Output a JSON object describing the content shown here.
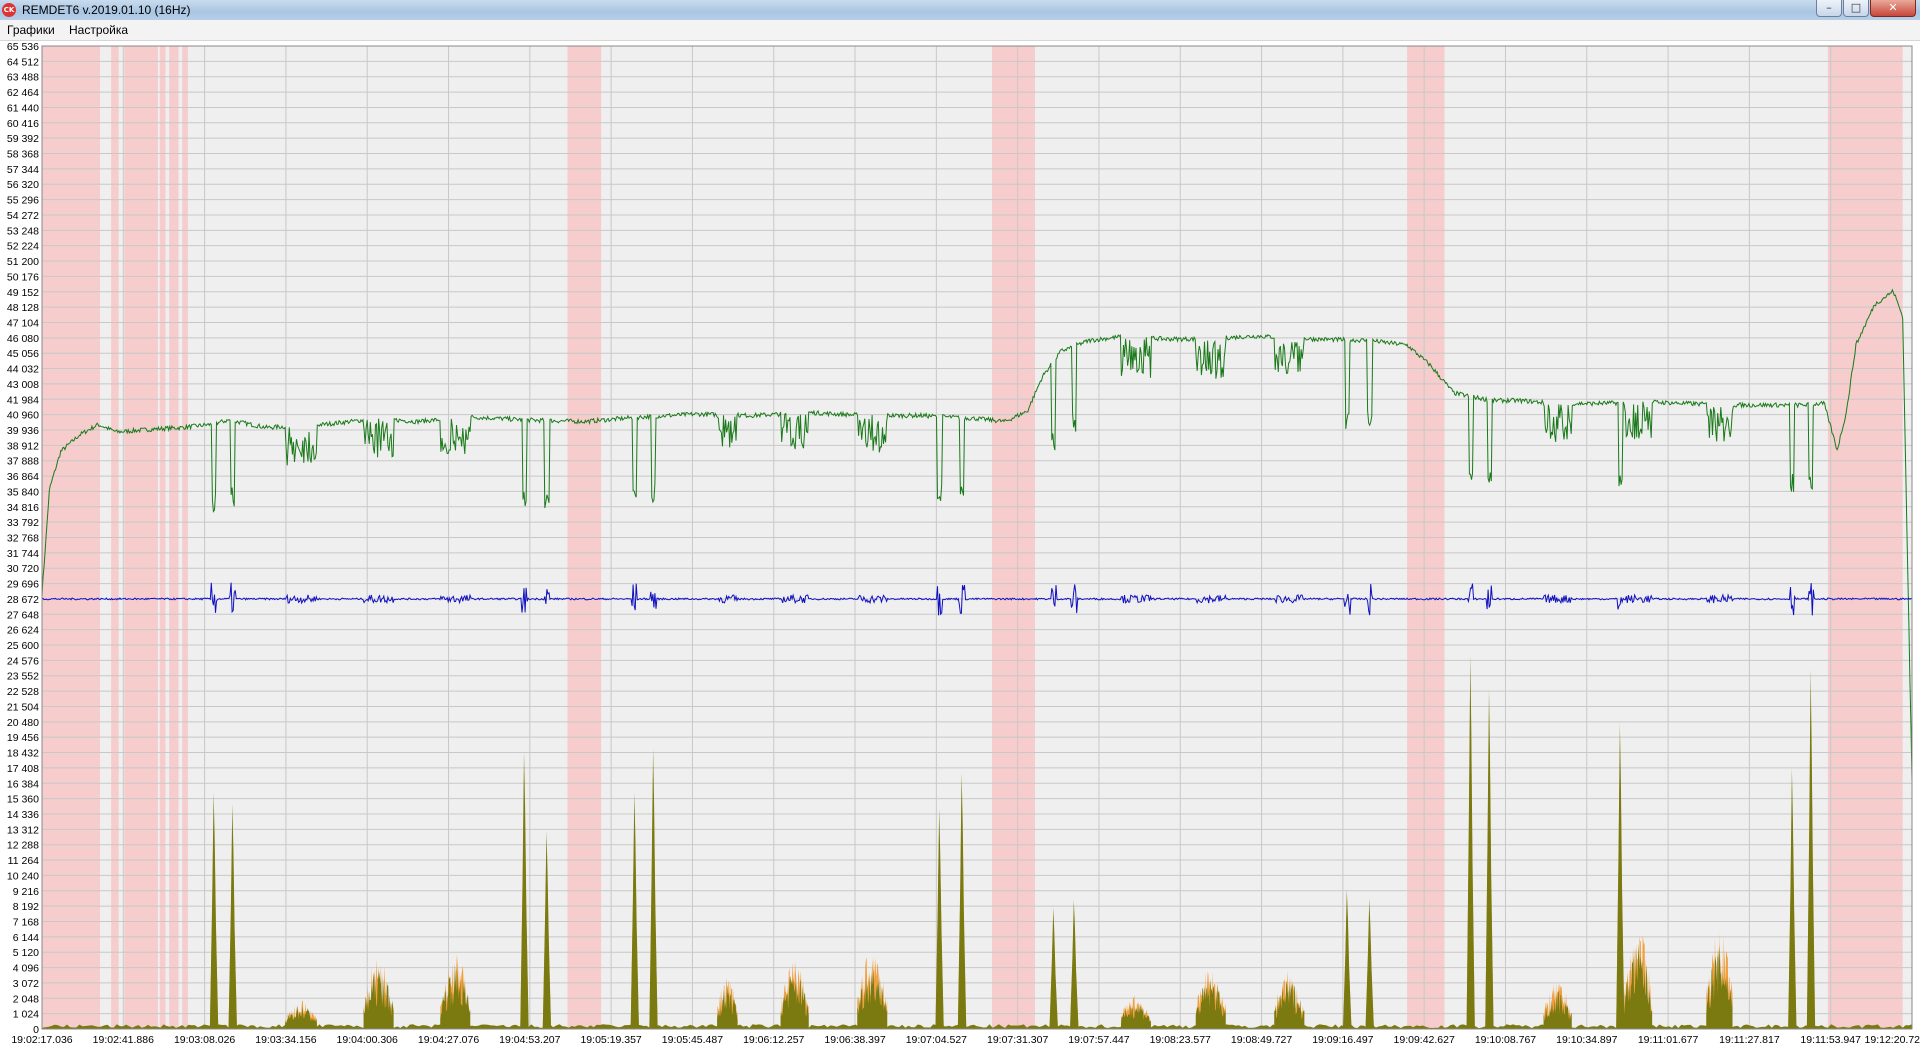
{
  "window": {
    "title": "REMDET6 v.2019.01.10 (16Hz)",
    "icon_text": "CK",
    "controls": {
      "minimize": "–",
      "maximize": "□",
      "close": "✕"
    }
  },
  "menu": {
    "items": [
      "Графики",
      "Настройка"
    ]
  },
  "colors": {
    "highlight": "#f6cccc",
    "green": "#1a7a1a",
    "blue": "#1010c0",
    "orange": "#f0a040",
    "olive": "#7a7a10",
    "grid": "#c8c8c8",
    "bg": "#efefef"
  },
  "chart_data": {
    "type": "line",
    "ylim": [
      0,
      65536
    ],
    "y_ticks": [
      "65 536",
      "64 512",
      "63 488",
      "62 464",
      "61 440",
      "60 416",
      "59 392",
      "58 368",
      "57 344",
      "56 320",
      "55 296",
      "54 272",
      "53 248",
      "52 224",
      "51 200",
      "50 176",
      "49 152",
      "48 128",
      "47 104",
      "46 080",
      "45 056",
      "44 032",
      "43 008",
      "41 984",
      "40 960",
      "39 936",
      "38 912",
      "37 888",
      "36 864",
      "35 840",
      "34 816",
      "33 792",
      "32 768",
      "31 744",
      "30 720",
      "29 696",
      "28 672",
      "27 648",
      "26 624",
      "25 600",
      "24 576",
      "23 552",
      "22 528",
      "21 504",
      "20 480",
      "19 456",
      "18 432",
      "17 408",
      "16 384",
      "15 360",
      "14 336",
      "13 312",
      "12 288",
      "11 264",
      "10 240",
      "9 216",
      "8 192",
      "7 168",
      "6 144",
      "5 120",
      "4 096",
      "3 072",
      "2 048",
      "1 024",
      "0"
    ],
    "x_ticks": [
      "19:02:17.036",
      "19:02:41.886",
      "19:03:08.026",
      "19:03:34.156",
      "19:04:00.306",
      "19:04:27.076",
      "19:04:53.207",
      "19:05:19.357",
      "19:05:45.487",
      "19:06:12.257",
      "19:06:38.397",
      "19:07:04.527",
      "19:07:31.307",
      "19:07:57.447",
      "19:08:23.577",
      "19:08:49.727",
      "19:09:16.497",
      "19:09:42.627",
      "19:10:08.767",
      "19:10:34.897",
      "19:11:01.677",
      "19:11:27.817",
      "19:11:53.947",
      "19:12:20.72"
    ],
    "highlight_bands": [
      [
        0.0,
        0.031
      ],
      [
        0.037,
        0.041
      ],
      [
        0.044,
        0.062
      ],
      [
        0.063,
        0.066
      ],
      [
        0.068,
        0.073
      ],
      [
        0.075,
        0.078
      ],
      [
        0.281,
        0.299
      ],
      [
        0.508,
        0.531
      ],
      [
        0.73,
        0.75
      ],
      [
        0.955,
        0.995
      ]
    ],
    "series": [
      {
        "color": "#1a7a1a",
        "points": [
          [
            0.0,
            29000
          ],
          [
            0.004,
            36000
          ],
          [
            0.01,
            38500
          ],
          [
            0.02,
            39600
          ],
          [
            0.03,
            40300
          ],
          [
            0.04,
            39800
          ],
          [
            0.06,
            40000
          ],
          [
            0.075,
            40100
          ],
          [
            0.09,
            40300
          ],
          [
            0.1,
            40600
          ],
          [
            0.12,
            40100
          ],
          [
            0.15,
            40300
          ],
          [
            0.18,
            40700
          ],
          [
            0.2,
            40500
          ],
          [
            0.23,
            40800
          ],
          [
            0.26,
            40600
          ],
          [
            0.29,
            40500
          ],
          [
            0.32,
            40800
          ],
          [
            0.35,
            41000
          ],
          [
            0.38,
            40900
          ],
          [
            0.41,
            41100
          ],
          [
            0.44,
            40900
          ],
          [
            0.47,
            40900
          ],
          [
            0.5,
            40700
          ],
          [
            0.515,
            40500
          ],
          [
            0.527,
            41200
          ],
          [
            0.535,
            43500
          ],
          [
            0.545,
            45200
          ],
          [
            0.56,
            45900
          ],
          [
            0.58,
            46200
          ],
          [
            0.6,
            46000
          ],
          [
            0.62,
            46000
          ],
          [
            0.65,
            46200
          ],
          [
            0.68,
            46000
          ],
          [
            0.71,
            45900
          ],
          [
            0.73,
            45600
          ],
          [
            0.742,
            44300
          ],
          [
            0.755,
            42400
          ],
          [
            0.775,
            41900
          ],
          [
            0.79,
            41900
          ],
          [
            0.81,
            41700
          ],
          [
            0.83,
            41700
          ],
          [
            0.86,
            41800
          ],
          [
            0.88,
            41700
          ],
          [
            0.9,
            41600
          ],
          [
            0.92,
            41600
          ],
          [
            0.94,
            41600
          ],
          [
            0.953,
            41700
          ],
          [
            0.96,
            38600
          ],
          [
            0.965,
            41200
          ],
          [
            0.97,
            45600
          ],
          [
            0.98,
            48300
          ],
          [
            0.99,
            49200
          ],
          [
            0.995,
            47500
          ],
          [
            1.0,
            16500
          ]
        ]
      },
      {
        "color": "#1010c0",
        "baseline": 28672
      },
      {
        "color": "#7a7a10"
      },
      {
        "color": "#f0a040"
      }
    ],
    "events": [
      {
        "x": 0.092,
        "h": 15800
      },
      {
        "x": 0.102,
        "h": 15000
      },
      {
        "x": 0.258,
        "h": 18500
      },
      {
        "x": 0.27,
        "h": 13200
      },
      {
        "x": 0.317,
        "h": 15800
      },
      {
        "x": 0.327,
        "h": 18700
      },
      {
        "x": 0.48,
        "h": 14700
      },
      {
        "x": 0.492,
        "h": 17100
      },
      {
        "x": 0.541,
        "h": 8100
      },
      {
        "x": 0.552,
        "h": 8600
      },
      {
        "x": 0.698,
        "h": 9300
      },
      {
        "x": 0.71,
        "h": 8700
      },
      {
        "x": 0.764,
        "h": 24900
      },
      {
        "x": 0.774,
        "h": 22700
      },
      {
        "x": 0.844,
        "h": 20400
      },
      {
        "x": 0.936,
        "h": 17400
      },
      {
        "x": 0.946,
        "h": 24000
      }
    ],
    "bursts": [
      {
        "x0": 0.13,
        "x1": 0.147,
        "h": 2100
      },
      {
        "x0": 0.172,
        "x1": 0.188,
        "h": 5200
      },
      {
        "x0": 0.213,
        "x1": 0.229,
        "h": 5500
      },
      {
        "x0": 0.361,
        "x1": 0.372,
        "h": 3800
      },
      {
        "x0": 0.395,
        "x1": 0.41,
        "h": 5000
      },
      {
        "x0": 0.436,
        "x1": 0.452,
        "h": 5700
      },
      {
        "x0": 0.577,
        "x1": 0.593,
        "h": 2500
      },
      {
        "x0": 0.617,
        "x1": 0.633,
        "h": 4400
      },
      {
        "x0": 0.659,
        "x1": 0.675,
        "h": 4200
      },
      {
        "x0": 0.803,
        "x1": 0.818,
        "h": 3400
      },
      {
        "x0": 0.846,
        "x1": 0.861,
        "h": 7200
      },
      {
        "x0": 0.89,
        "x1": 0.904,
        "h": 7100
      }
    ]
  }
}
